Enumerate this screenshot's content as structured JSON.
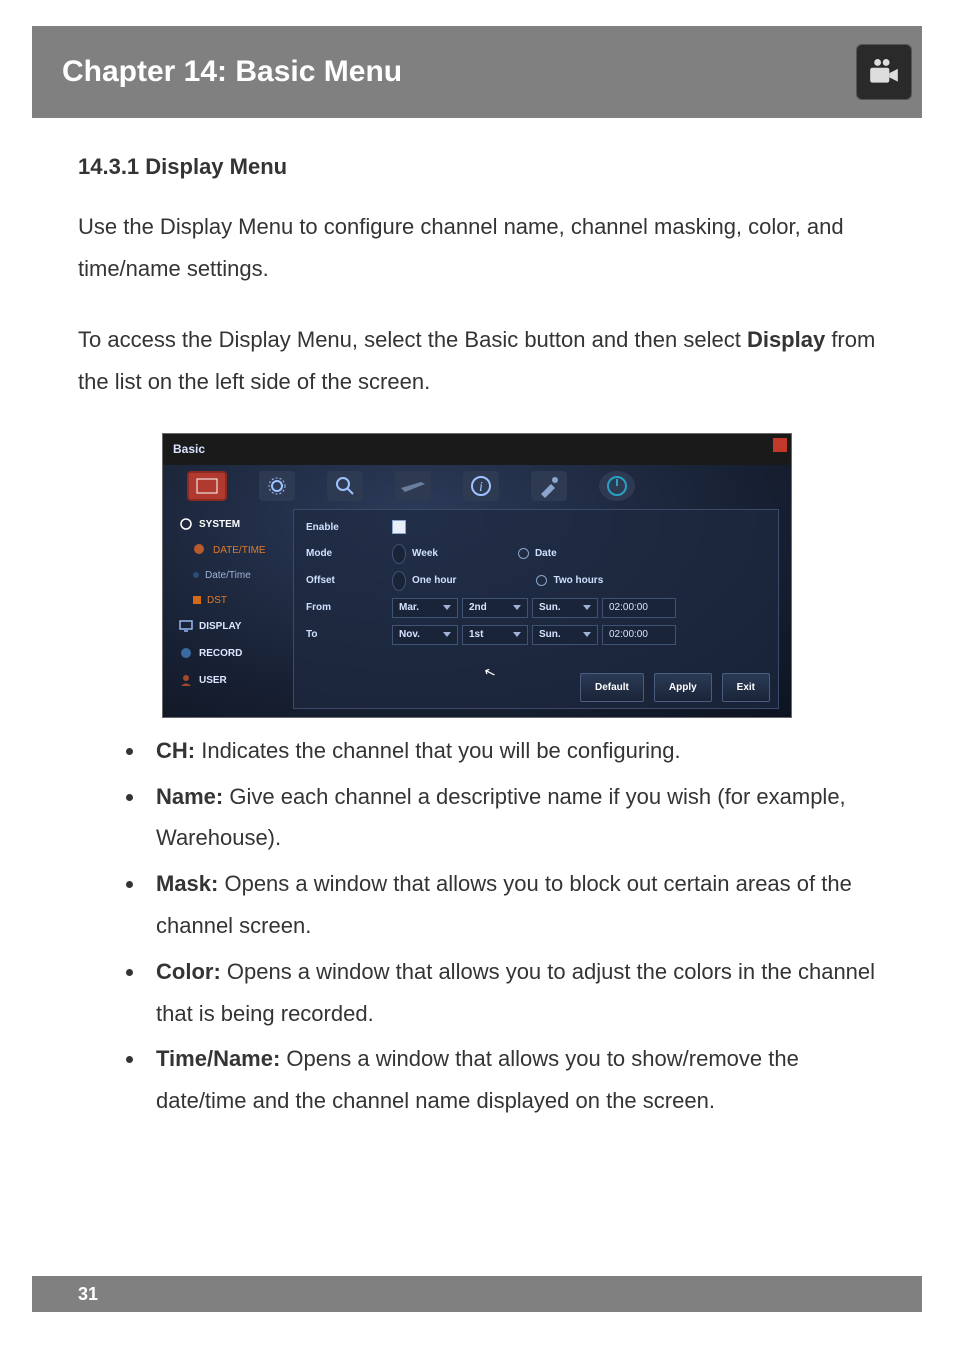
{
  "chapter_title": "Chapter 14: Basic Menu",
  "section_heading": "14.3.1 Display Menu",
  "intro": "Use the Display Menu to configure channel name, channel masking, color, and time/name settings.",
  "access_line_a": "To access the Display Menu, select the Basic button and then select ",
  "access_line_b_bold": "Display",
  "access_line_c": " from the list on the left side of the screen.",
  "page_number": "31",
  "bullets": [
    {
      "term": "CH:",
      "desc": " Indicates the channel that you will be configuring."
    },
    {
      "term": "Name:",
      "desc": " Give each channel a descriptive name if you wish (for example, Warehouse)."
    },
    {
      "term": "Mask:",
      "desc": " Opens a window that allows you to block out certain areas of the channel screen."
    },
    {
      "term": "Color:",
      "desc": " Opens a window that allows you to adjust the colors in the channel that is being recorded."
    },
    {
      "term": "Time/Name:",
      "desc": " Opens a window that allows you to show/remove the date/time and the channel name displayed on the screen."
    }
  ],
  "shot": {
    "window_title": "Basic",
    "sidebar": {
      "system": "SYSTEM",
      "datetime_group": "DATE/TIME",
      "datetime_sub": "Date/Time",
      "dst_sub": "DST",
      "display": "DISPLAY",
      "record": "RECORD",
      "user": "USER"
    },
    "form": {
      "enable_label": "Enable",
      "mode_label": "Mode",
      "mode_opt1": "Week",
      "mode_opt2": "Date",
      "offset_label": "Offset",
      "offset_opt1": "One hour",
      "offset_opt2": "Two hours",
      "from_label": "From",
      "to_label": "To",
      "from_month": "Mar.",
      "from_ord": "2nd",
      "from_day": "Sun.",
      "from_time": "02:00:00",
      "to_month": "Nov.",
      "to_ord": "1st",
      "to_day": "Sun.",
      "to_time": "02:00:00"
    },
    "buttons": {
      "default": "Default",
      "apply": "Apply",
      "exit": "Exit"
    }
  }
}
